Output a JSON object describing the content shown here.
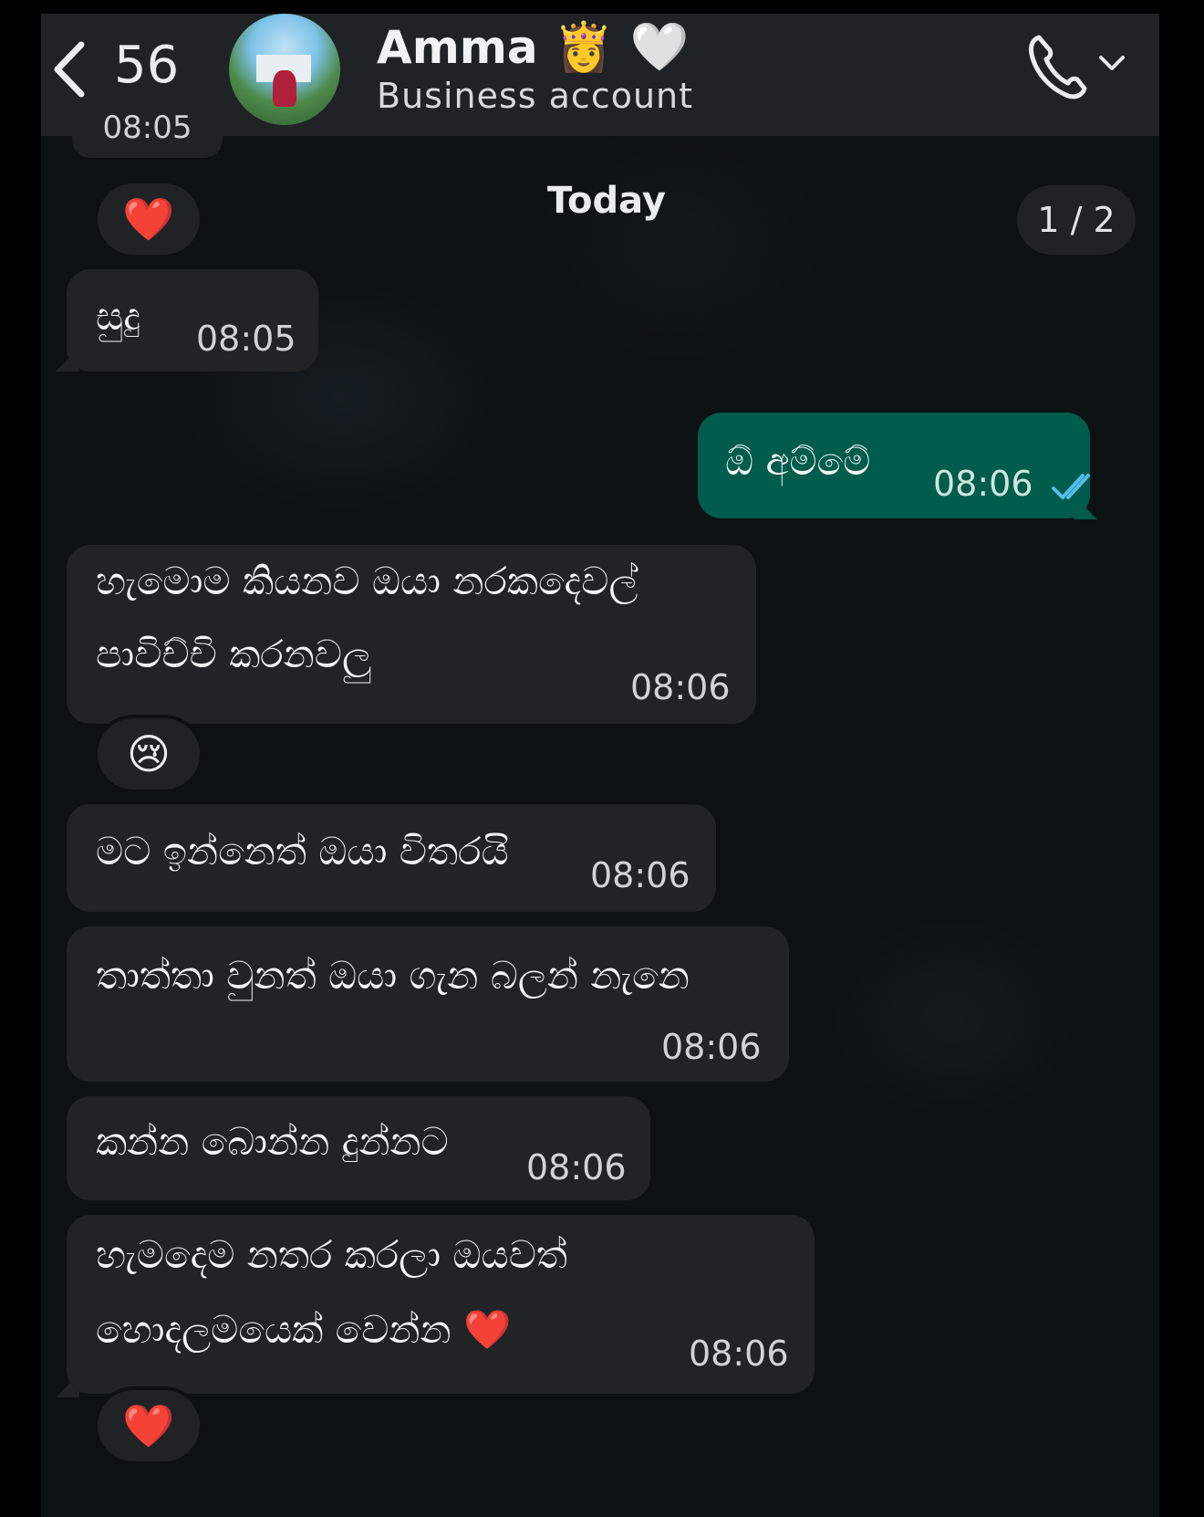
{
  "header": {
    "unread_count": "56",
    "contact_name": "Amma",
    "name_emojis": "👸 🤍",
    "subtitle": "Business account"
  },
  "top_stub_time": "08:05",
  "today_label": "Today",
  "pager": "1 / 2",
  "reactions": {
    "r1": "❤️",
    "r2": "😢",
    "r3": "❤️"
  },
  "messages": [
    {
      "direction": "in",
      "text": "සුදු",
      "time": "08:05"
    },
    {
      "direction": "out",
      "text": "ඕ අම්මේ",
      "time": "08:06",
      "status": "read"
    },
    {
      "direction": "in",
      "lines": [
        "හැමොම කියනව ඔයා නරකදෙවල්",
        "පාවිච්චි කරනවලු"
      ],
      "time": "08:06"
    },
    {
      "direction": "in",
      "text": "මට ඉන්නෙත් ඔයා විතරයි",
      "time": "08:06"
    },
    {
      "direction": "in",
      "text": "තාත්තා වුනත් ඔයා ගැන බලන් නැනෙ",
      "time": "08:06"
    },
    {
      "direction": "in",
      "text": "කන්න බොන්න දුන්නට",
      "time": "08:06"
    },
    {
      "direction": "in",
      "lines": [
        "හැමදෙම නතර කරලා ඔයවත්",
        "හොදලමයෙක් වෙන්න ❤️"
      ],
      "time": "08:06"
    }
  ],
  "colors": {
    "incoming_bubble": "#202427",
    "outgoing_bubble": "#005c4b",
    "read_ticks": "#53bdeb",
    "header_bg": "#1f2326"
  }
}
